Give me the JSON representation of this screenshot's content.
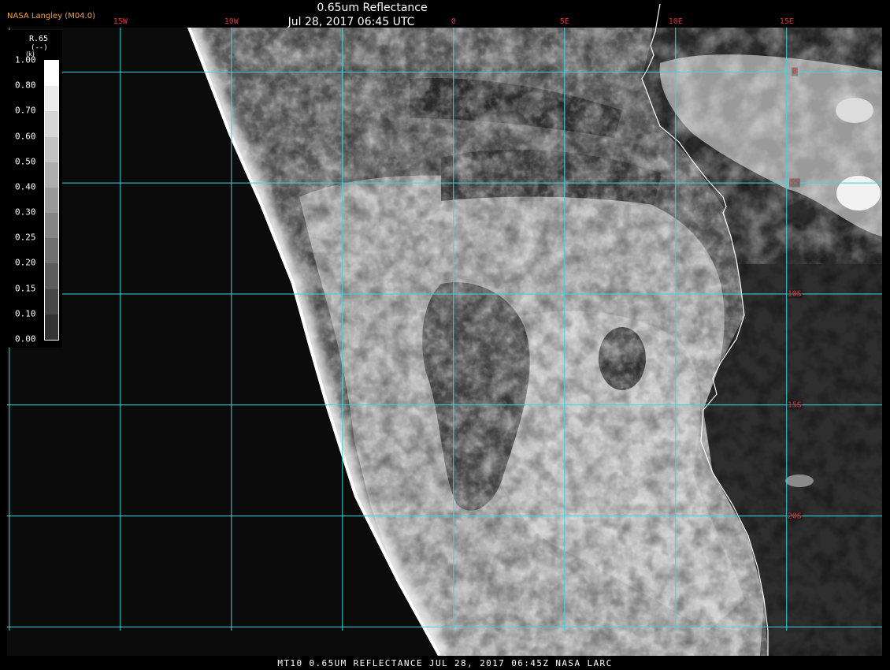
{
  "header": {
    "institution": "NASA Langley (M04.0)",
    "product_title": "0.65um Reflectance",
    "valid_time": "Jul 28, 2017 06:45 UTC"
  },
  "footer": {
    "caption": "MT10  0.65UM REFLECTANCE   JUL 28, 2017 06:45Z   NASA LARC"
  },
  "map": {
    "region": "Southeast Atlantic Ocean / southwest Africa coast",
    "grid_color": "#39d6e0",
    "label_color": "#e0322f",
    "coastline_color": "#ffffff",
    "lon_labels": [
      {
        "label": "15W",
        "lon": -15
      },
      {
        "label": "10W",
        "lon": -10
      },
      {
        "label": "0",
        "lon": 0
      },
      {
        "label": "5E",
        "lon": 5
      },
      {
        "label": "10E",
        "lon": 10
      },
      {
        "label": "15E",
        "lon": 15
      }
    ],
    "lat_labels": [
      {
        "label": "0",
        "lat": 0
      },
      {
        "label": "5S",
        "lat": -5
      },
      {
        "label": "10S",
        "lat": -10
      },
      {
        "label": "15S",
        "lat": -15
      },
      {
        "label": "20S",
        "lat": -20
      }
    ],
    "lat_lines": [
      0,
      -5,
      -10,
      -15,
      -20,
      -25
    ],
    "lon_lines": [
      -20,
      -15,
      -10,
      -5,
      0,
      5,
      10,
      15
    ],
    "extent": {
      "lon_min": -20.1,
      "lon_max": 19.3,
      "lat_max": 2.0,
      "lat_min": -26.3
    }
  },
  "legend": {
    "title": "R.65",
    "units": "(--)",
    "k_mark": "(k)",
    "levels": [
      {
        "value": "1.00",
        "gray": "#ffffff"
      },
      {
        "value": "0.80",
        "gray": "#ebebeb"
      },
      {
        "value": "0.70",
        "gray": "#d6d6d6"
      },
      {
        "value": "0.60",
        "gray": "#c2c2c2"
      },
      {
        "value": "0.50",
        "gray": "#adadad"
      },
      {
        "value": "0.40",
        "gray": "#999999"
      },
      {
        "value": "0.30",
        "gray": "#858585"
      },
      {
        "value": "0.25",
        "gray": "#707070"
      },
      {
        "value": "0.20",
        "gray": "#5c5c5c"
      },
      {
        "value": "0.15",
        "gray": "#474747"
      },
      {
        "value": "0.10",
        "gray": "#333333"
      },
      {
        "value": "0.00",
        "gray": "#1a1a1a"
      }
    ]
  }
}
